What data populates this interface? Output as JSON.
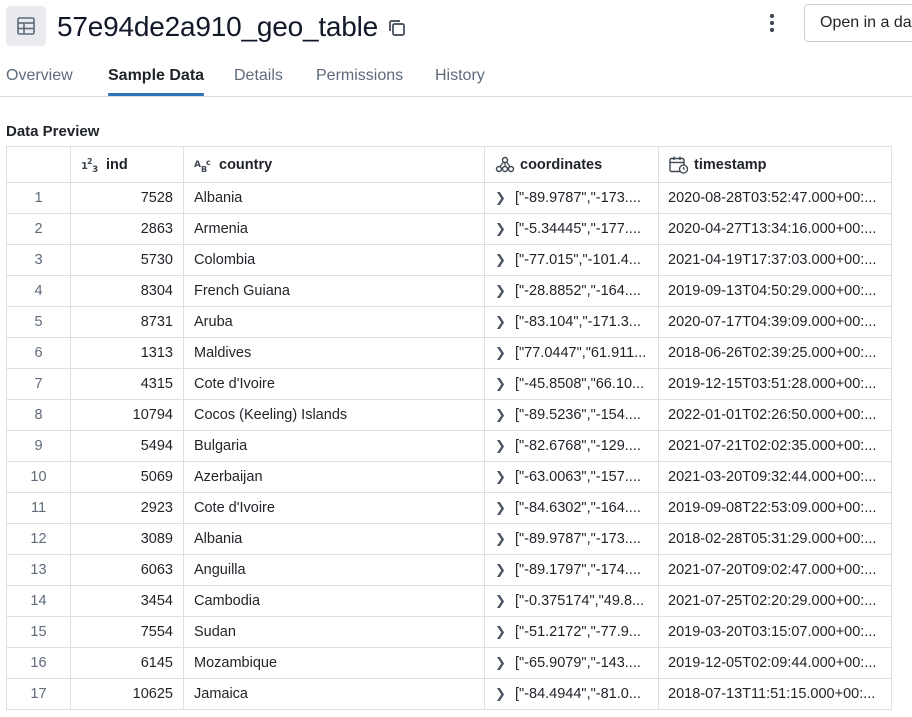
{
  "header": {
    "title": "57e94de2a910_geo_table",
    "open_button_label": "Open in a dashboard",
    "icons": [
      "table-icon",
      "copy-icon",
      "kebab-menu-icon"
    ]
  },
  "tabs": [
    {
      "label": "Overview",
      "active": false
    },
    {
      "label": "Sample Data",
      "active": true
    },
    {
      "label": "Details",
      "active": false
    },
    {
      "label": "Permissions",
      "active": false
    },
    {
      "label": "History",
      "active": false
    }
  ],
  "section_title": "Data Preview",
  "columns": [
    {
      "label": "",
      "type_icon": ""
    },
    {
      "label": "ind",
      "type_icon": "integer-type-icon"
    },
    {
      "label": "country",
      "type_icon": "string-type-icon"
    },
    {
      "label": "coordinates",
      "type_icon": "struct-type-icon"
    },
    {
      "label": "timestamp",
      "type_icon": "timestamp-type-icon"
    }
  ],
  "rows": [
    {
      "n": "1",
      "ind": "7528",
      "country": "Albania",
      "coordinates": "[\"-89.9787\",\"-173....",
      "timestamp": "2020-08-28T03:52:47.000+00:..."
    },
    {
      "n": "2",
      "ind": "2863",
      "country": "Armenia",
      "coordinates": "[\"-5.34445\",\"-177....",
      "timestamp": "2020-04-27T13:34:16.000+00:..."
    },
    {
      "n": "3",
      "ind": "5730",
      "country": "Colombia",
      "coordinates": "[\"-77.015\",\"-101.4...",
      "timestamp": "2021-04-19T17:37:03.000+00:..."
    },
    {
      "n": "4",
      "ind": "8304",
      "country": "French Guiana",
      "coordinates": "[\"-28.8852\",\"-164....",
      "timestamp": "2019-09-13T04:50:29.000+00:..."
    },
    {
      "n": "5",
      "ind": "8731",
      "country": "Aruba",
      "coordinates": "[\"-83.104\",\"-171.3...",
      "timestamp": "2020-07-17T04:39:09.000+00:..."
    },
    {
      "n": "6",
      "ind": "1313",
      "country": "Maldives",
      "coordinates": "[\"77.0447\",\"61.911...",
      "timestamp": "2018-06-26T02:39:25.000+00:..."
    },
    {
      "n": "7",
      "ind": "4315",
      "country": "Cote d'Ivoire",
      "coordinates": "[\"-45.8508\",\"66.10...",
      "timestamp": "2019-12-15T03:51:28.000+00:..."
    },
    {
      "n": "8",
      "ind": "10794",
      "country": "Cocos (Keeling) Islands",
      "coordinates": "[\"-89.5236\",\"-154....",
      "timestamp": "2022-01-01T02:26:50.000+00:..."
    },
    {
      "n": "9",
      "ind": "5494",
      "country": "Bulgaria",
      "coordinates": "[\"-82.6768\",\"-129....",
      "timestamp": "2021-07-21T02:02:35.000+00:..."
    },
    {
      "n": "10",
      "ind": "5069",
      "country": "Azerbaijan",
      "coordinates": "[\"-63.0063\",\"-157....",
      "timestamp": "2021-03-20T09:32:44.000+00:..."
    },
    {
      "n": "11",
      "ind": "2923",
      "country": "Cote d'Ivoire",
      "coordinates": "[\"-84.6302\",\"-164....",
      "timestamp": "2019-09-08T22:53:09.000+00:..."
    },
    {
      "n": "12",
      "ind": "3089",
      "country": "Albania",
      "coordinates": "[\"-89.9787\",\"-173....",
      "timestamp": "2018-02-28T05:31:29.000+00:..."
    },
    {
      "n": "13",
      "ind": "6063",
      "country": "Anguilla",
      "coordinates": "[\"-89.1797\",\"-174....",
      "timestamp": "2021-07-20T09:02:47.000+00:..."
    },
    {
      "n": "14",
      "ind": "3454",
      "country": "Cambodia",
      "coordinates": "[\"-0.375174\",\"49.8...",
      "timestamp": "2021-07-25T02:20:29.000+00:..."
    },
    {
      "n": "15",
      "ind": "7554",
      "country": "Sudan",
      "coordinates": "[\"-51.2172\",\"-77.9...",
      "timestamp": "2019-03-20T03:15:07.000+00:..."
    },
    {
      "n": "16",
      "ind": "6145",
      "country": "Mozambique",
      "coordinates": "[\"-65.9079\",\"-143....",
      "timestamp": "2019-12-05T02:09:44.000+00:..."
    },
    {
      "n": "17",
      "ind": "10625",
      "country": "Jamaica",
      "coordinates": "[\"-84.4944\",\"-81.0...",
      "timestamp": "2018-07-13T11:51:15.000+00:..."
    }
  ],
  "colors": {
    "accent": "#2b72b9",
    "border": "#dcdfe3",
    "muted_text": "#5f6b7a"
  }
}
